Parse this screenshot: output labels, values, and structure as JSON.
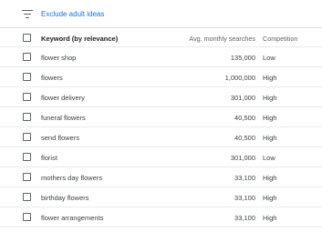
{
  "filter": {
    "link_label": "Exclude adult ideas"
  },
  "table": {
    "headers": {
      "keyword": "Keyword (by relevance)",
      "avg_searches": "Avg. monthly searches",
      "competition": "Competition"
    },
    "rows": [
      {
        "keyword": "flower shop",
        "avg_searches": "135,000",
        "competition": "Low"
      },
      {
        "keyword": "flowers",
        "avg_searches": "1,000,000",
        "competition": "High"
      },
      {
        "keyword": "flower delivery",
        "avg_searches": "301,000",
        "competition": "High"
      },
      {
        "keyword": "funeral flowers",
        "avg_searches": "40,500",
        "competition": "High"
      },
      {
        "keyword": "send flowers",
        "avg_searches": "40,500",
        "competition": "High"
      },
      {
        "keyword": "florist",
        "avg_searches": "301,000",
        "competition": "Low"
      },
      {
        "keyword": "mothers day flowers",
        "avg_searches": "33,100",
        "competition": "High"
      },
      {
        "keyword": "birthday flowers",
        "avg_searches": "33,100",
        "competition": "High"
      },
      {
        "keyword": "flower arrangements",
        "avg_searches": "33,100",
        "competition": "High"
      }
    ]
  }
}
